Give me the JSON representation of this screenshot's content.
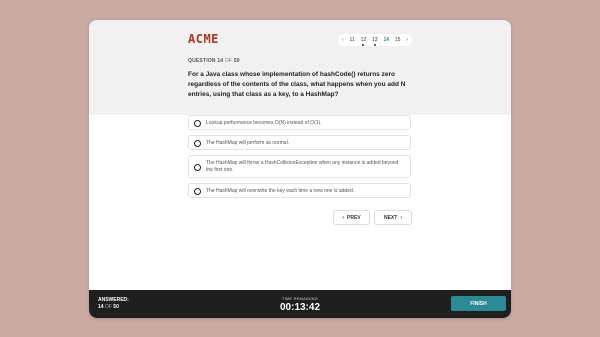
{
  "brand": {
    "logo": "ACME"
  },
  "pager": {
    "prev_icon": "‹",
    "next_icon": "›",
    "pages": [
      "11",
      "12",
      "13",
      "14",
      "15"
    ],
    "current": "14",
    "answered_marks": [
      "12",
      "13"
    ],
    "accent_color": "#2a8a96"
  },
  "question": {
    "label": "QUESTION",
    "number": "14",
    "of_word": "OF",
    "total": "50",
    "text": "For a Java class whose implementation of hashCode() returns zero regardless of the contents of the class, what happens when you add N entries, using that class as a key, to a HashMap?"
  },
  "options": [
    {
      "text": "Lookup performance becomes O(N) instead of O(1)."
    },
    {
      "text": "The HashMap will perform as normal."
    },
    {
      "text": "The HashMap will throw a HashCollisionException when any instance is added beyond the first one."
    },
    {
      "text": "The HashMap will overwrite the key each time a new one is added."
    }
  ],
  "nav": {
    "prev_label": "PREV",
    "next_label": "NEXT",
    "prev_icon": "‹",
    "next_icon": "›"
  },
  "footer": {
    "answered_label": "ANSWERED:",
    "answered_count": "14",
    "of_word": "OF",
    "answered_total": "50",
    "timer_label": "TIME REMAINING",
    "timer_value": "00:13:42",
    "finish_label": "FINISH",
    "finish_color": "#2a8a96"
  }
}
